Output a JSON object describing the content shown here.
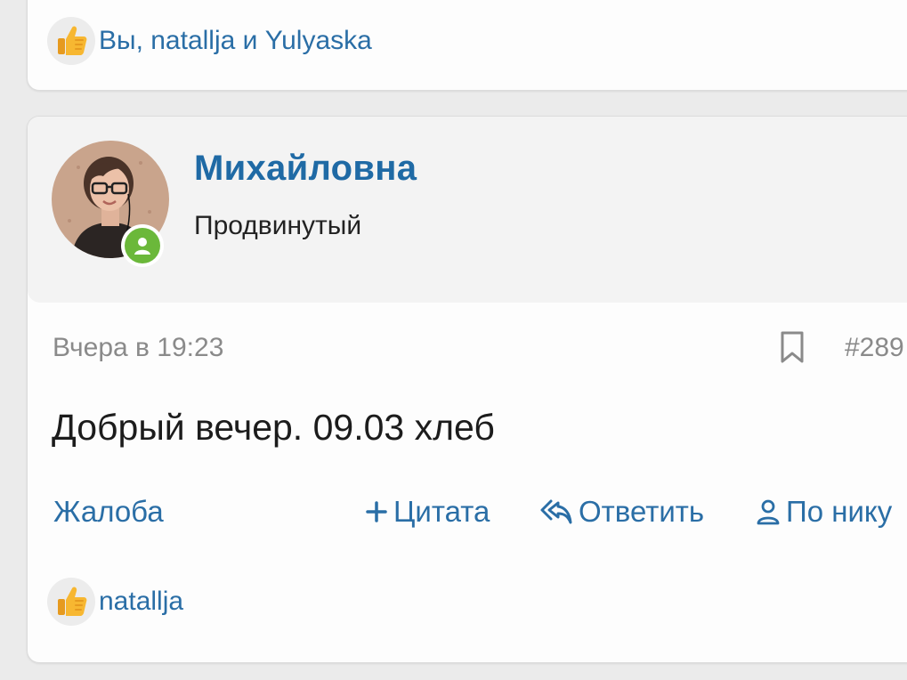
{
  "top_post": {
    "reactions_text": "Вы, natallja и Yulyaska",
    "reaction_icon": "thumbs-up-icon"
  },
  "post": {
    "author": {
      "name": "Михайловна",
      "title": "Продвинутый",
      "online": true
    },
    "date": "Вчера в 19:23",
    "number": "#289",
    "body": "Добрый вечер. 09.03 хлеб",
    "actions": {
      "report": "Жалоба",
      "quote": "Цитата",
      "reply": "Ответить",
      "by_nick": "По нику"
    },
    "reactions_text": "natallja",
    "reaction_icon": "thumbs-up-icon"
  },
  "colors": {
    "link": "#2a6ea6",
    "username": "#1f6aa5",
    "online": "#6bb83a",
    "background": "#ebebeb"
  }
}
